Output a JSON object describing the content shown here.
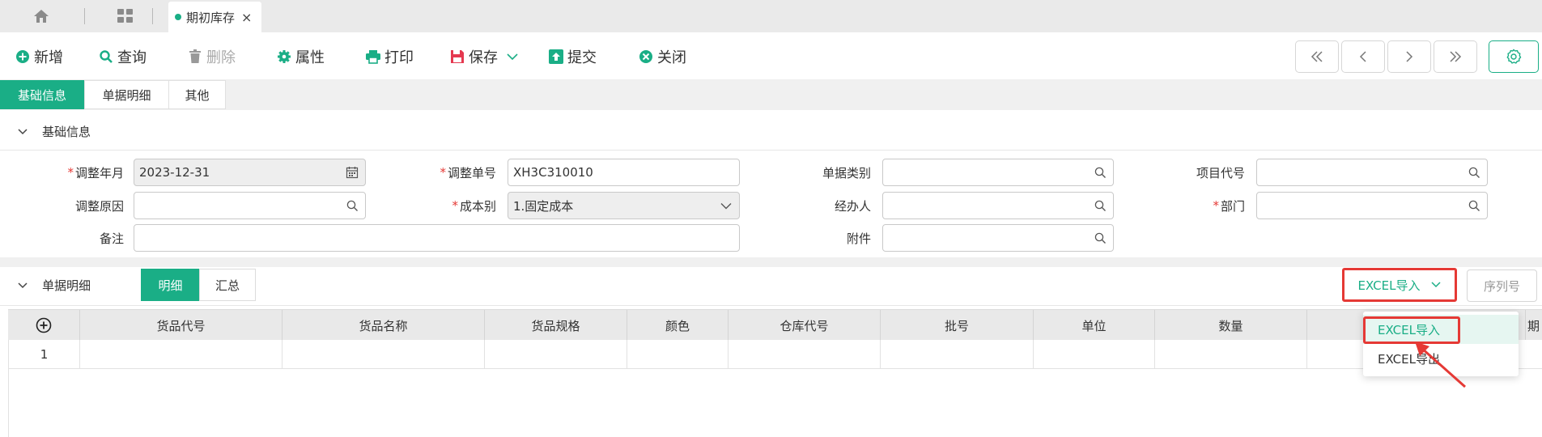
{
  "top_tabs": {
    "home_icon": "home-icon",
    "grid_icon": "grid-icon",
    "doc_tab_label": "期初库存",
    "close_glyph": "×"
  },
  "toolbar": {
    "new_label": "新增",
    "query_label": "查询",
    "delete_label": "删除",
    "properties_label": "属性",
    "print_label": "打印",
    "save_label": "保存",
    "submit_label": "提交",
    "close_label": "关闭"
  },
  "page_tabs": [
    "基础信息",
    "单据明细",
    "其他"
  ],
  "basic_section": {
    "title": "基础信息",
    "fields": {
      "adjust_date_label": "调整年月",
      "adjust_date_value": "2023-12-31",
      "adjust_no_label": "调整单号",
      "adjust_no_value": "XH3C310010",
      "doc_type_label": "单据类别",
      "project_code_label": "项目代号",
      "adjust_reason_label": "调整原因",
      "cost_type_label": "成本别",
      "cost_type_value": "1.固定成本",
      "handler_label": "经办人",
      "department_label": "部门",
      "remark_label": "备注",
      "attachment_label": "附件"
    }
  },
  "detail_section": {
    "title": "单据明细",
    "seg_detail": "明细",
    "seg_summary": "汇总",
    "excel_import_label": "EXCEL导入",
    "serial_label": "序列号",
    "columns": [
      "货品代号",
      "货品名称",
      "货品规格",
      "颜色",
      "仓库代号",
      "批号",
      "单位",
      "数量",
      "",
      "期"
    ],
    "rows": [
      {
        "index": "1"
      }
    ],
    "dropdown": [
      "EXCEL导入",
      "EXCEL导出"
    ]
  },
  "colors": {
    "accent": "#1aae86",
    "highlight_red": "#e53935"
  }
}
